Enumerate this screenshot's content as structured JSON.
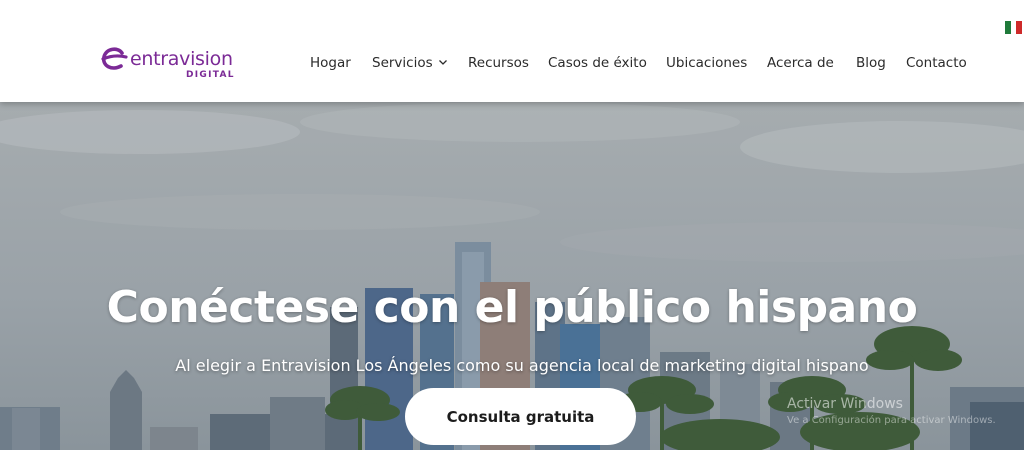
{
  "brand": {
    "name": "entravision",
    "sub": "DIGITAL",
    "color": "#7b2a96"
  },
  "nav": {
    "items": [
      {
        "label": "Hogar"
      },
      {
        "label": "Servicios",
        "has_dropdown": true
      },
      {
        "label": "Recursos"
      },
      {
        "label": "Casos de éxito"
      },
      {
        "label": "Ubicaciones"
      },
      {
        "label": "Acerca de"
      },
      {
        "label": "Blog"
      },
      {
        "label": "Contacto"
      }
    ],
    "language_flag": "mexico-flag-icon"
  },
  "hero": {
    "title": "Conéctese con el público hispano",
    "subtitle": "Al elegir a Entravision Los Ángeles como su agencia local de marketing digital hispano",
    "cta_label": "Consulta gratuita"
  },
  "watermark": {
    "line1": "Activar Windows",
    "line2": "Ve a Configuración para activar Windows."
  },
  "colors": {
    "sky": "#9aa3a8",
    "header_bg": "#ffffff",
    "text": "#2b2b2b"
  }
}
